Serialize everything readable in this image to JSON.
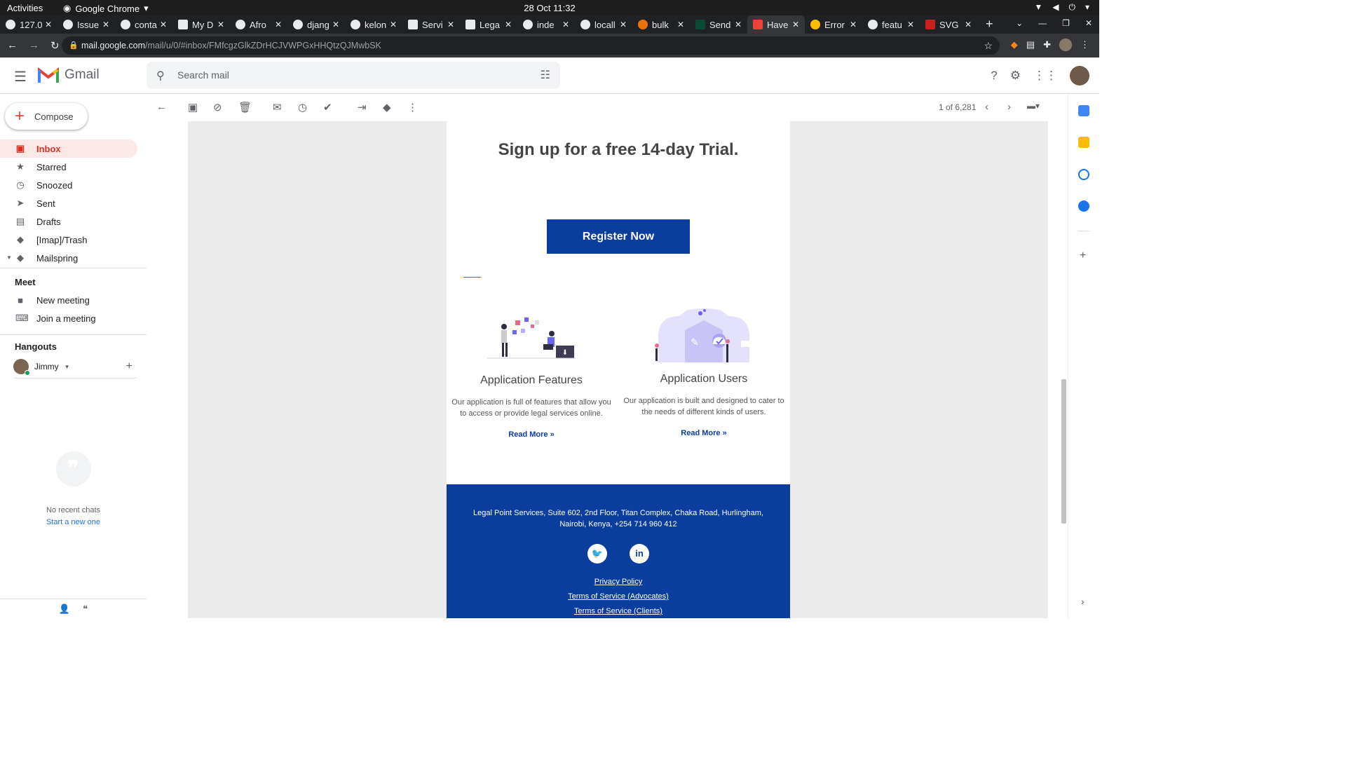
{
  "os": {
    "activities": "Activities",
    "app_name": "Google Chrome",
    "clock": "28 Oct  11:32"
  },
  "tabs": [
    {
      "title": "127.0"
    },
    {
      "title": "Issue"
    },
    {
      "title": "conta"
    },
    {
      "title": "My D"
    },
    {
      "title": "Afro"
    },
    {
      "title": "djang"
    },
    {
      "title": "kelon"
    },
    {
      "title": "Servi"
    },
    {
      "title": "Lega"
    },
    {
      "title": "inde"
    },
    {
      "title": "locall"
    },
    {
      "title": "bulk"
    },
    {
      "title": "Send"
    },
    {
      "title": "Have"
    },
    {
      "title": "Error"
    },
    {
      "title": "featu"
    },
    {
      "title": "SVG"
    }
  ],
  "address": {
    "host": "mail.google.com",
    "path": "/mail/u/0/#inbox/FMfcgzGlkZDrHCJVWPGxHHQtzQJMwbSK"
  },
  "gmail": {
    "brand": "Gmail",
    "search_placeholder": "Search mail"
  },
  "compose": {
    "label": "Compose"
  },
  "nav": [
    {
      "label": "Inbox",
      "icon": "inbox-icon"
    },
    {
      "label": "Starred",
      "icon": "star-icon"
    },
    {
      "label": "Snoozed",
      "icon": "clock-icon"
    },
    {
      "label": "Sent",
      "icon": "send-icon"
    },
    {
      "label": "Drafts",
      "icon": "draft-icon"
    },
    {
      "label": "[Imap]/Trash",
      "icon": "label-icon"
    },
    {
      "label": "Mailspring",
      "icon": "label-icon"
    }
  ],
  "meet": {
    "heading": "Meet",
    "new_meeting": "New meeting",
    "join_meeting": "Join a meeting"
  },
  "hangouts": {
    "heading": "Hangouts",
    "user": "Jimmy",
    "no_chats": "No recent chats",
    "start_new": "Start a new one"
  },
  "toolbar": {
    "count": "1 of 6,281"
  },
  "email": {
    "heading": "Sign up for a free 14-day Trial.",
    "cta": "Register Now",
    "features": [
      {
        "title": "Application Features",
        "body": "Our application is full of features that allow you to access or provide legal services online.",
        "link": "Read More »"
      },
      {
        "title": "Application Users",
        "body": "Our application is built and designed to cater to the needs of different kinds of users.",
        "link": "Read More »"
      }
    ],
    "footer": {
      "address": "Legal Point Services, Suite 602, 2nd Floor, Titan Complex, Chaka Road, Hurlingham, Nairobi, Kenya, +254 714 960 412",
      "links": [
        "Privacy Policy",
        "Terms of Service (Advocates)",
        "Terms of Service (Clients)"
      ]
    }
  },
  "colors": {
    "brand_blue": "#0a3d9e",
    "inbox_red": "#d93025",
    "inbox_bg": "#fce8e6"
  }
}
